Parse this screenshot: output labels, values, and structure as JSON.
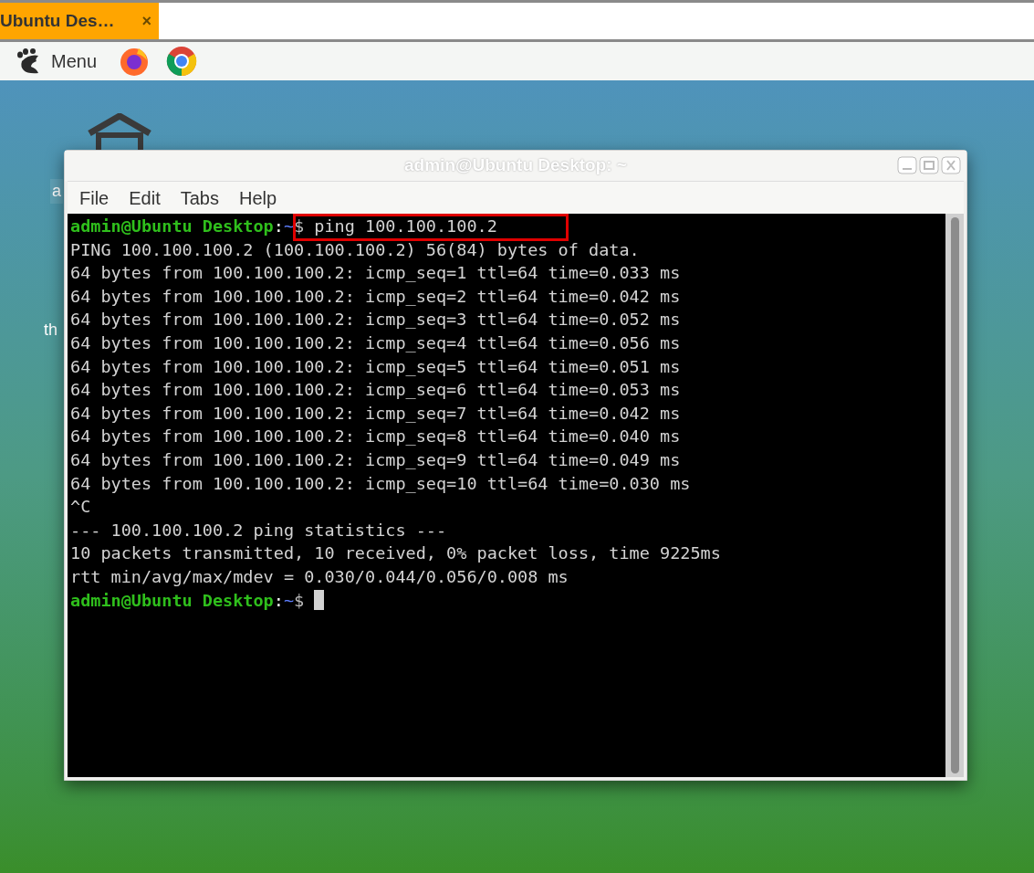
{
  "browser_tab": {
    "title": "Ubuntu Des…",
    "close": "×"
  },
  "taskbar": {
    "menu_label": "Menu"
  },
  "desktop": {
    "icon_labels": [
      "a",
      "th"
    ]
  },
  "terminal": {
    "title": "admin@Ubuntu Desktop: ~",
    "menu": [
      "File",
      "Edit",
      "Tabs",
      "Help"
    ],
    "lines": [
      {
        "kind": "prompt",
        "user": "admin@Ubuntu Desktop",
        "sep": ":",
        "path": "~",
        "symbol": "$",
        "command": " ping 100.100.100.2",
        "highlighted": true,
        "cursor": false
      },
      {
        "kind": "output",
        "text": "PING 100.100.100.2 (100.100.100.2) 56(84) bytes of data."
      },
      {
        "kind": "output",
        "text": "64 bytes from 100.100.100.2: icmp_seq=1 ttl=64 time=0.033 ms"
      },
      {
        "kind": "output",
        "text": "64 bytes from 100.100.100.2: icmp_seq=2 ttl=64 time=0.042 ms"
      },
      {
        "kind": "output",
        "text": "64 bytes from 100.100.100.2: icmp_seq=3 ttl=64 time=0.052 ms"
      },
      {
        "kind": "output",
        "text": "64 bytes from 100.100.100.2: icmp_seq=4 ttl=64 time=0.056 ms"
      },
      {
        "kind": "output",
        "text": "64 bytes from 100.100.100.2: icmp_seq=5 ttl=64 time=0.051 ms"
      },
      {
        "kind": "output",
        "text": "64 bytes from 100.100.100.2: icmp_seq=6 ttl=64 time=0.053 ms"
      },
      {
        "kind": "output",
        "text": "64 bytes from 100.100.100.2: icmp_seq=7 ttl=64 time=0.042 ms"
      },
      {
        "kind": "output",
        "text": "64 bytes from 100.100.100.2: icmp_seq=8 ttl=64 time=0.040 ms"
      },
      {
        "kind": "output",
        "text": "64 bytes from 100.100.100.2: icmp_seq=9 ttl=64 time=0.049 ms"
      },
      {
        "kind": "output",
        "text": "64 bytes from 100.100.100.2: icmp_seq=10 ttl=64 time=0.030 ms"
      },
      {
        "kind": "output",
        "text": "^C"
      },
      {
        "kind": "output",
        "text": "--- 100.100.100.2 ping statistics ---"
      },
      {
        "kind": "output",
        "text": "10 packets transmitted, 10 received, 0% packet loss, time 9225ms"
      },
      {
        "kind": "output",
        "text": "rtt min/avg/max/mdev = 0.030/0.044/0.056/0.008 ms"
      },
      {
        "kind": "prompt",
        "user": "admin@Ubuntu Desktop",
        "sep": ":",
        "path": "~",
        "symbol": "$",
        "highlighted": false,
        "cursor": true
      }
    ]
  }
}
